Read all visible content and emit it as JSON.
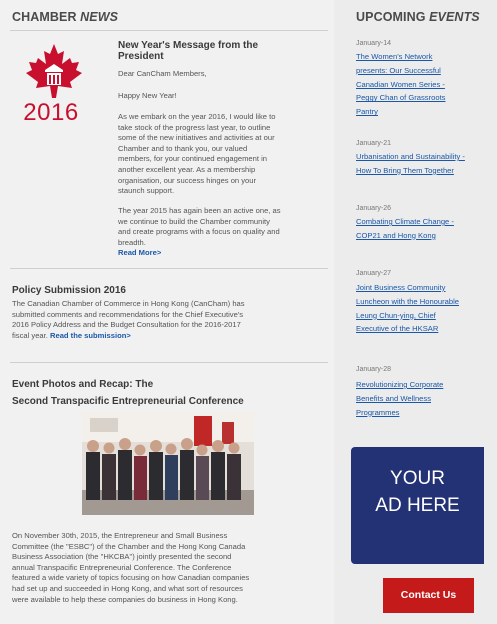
{
  "chamber_news": {
    "heading_main": "CHAMBER ",
    "heading_em": "NEWS",
    "logo_year": "2016",
    "article1": {
      "title_line1": "New Year's Message from the",
      "title_line2": "President",
      "salutation": "Dear CanCham Members,",
      "greeting": "Happy New Year!",
      "para1": [
        "As we embark on the year 2016, I would like to",
        "take stock of the progress last year, to outline",
        "some of the new initiatives and activities at our",
        "Chamber and to thank you, our valued",
        "members, for your continued engagement in",
        "another excellent year. As a membership",
        "organisation, our success hinges on your",
        "staunch support."
      ],
      "para2": [
        "The year 2015 has again been an active one, as",
        "we continue to build the Chamber community",
        "and create programs with a focus on quality and",
        "breadth."
      ],
      "read_more": "Read More>"
    },
    "article2": {
      "title": "Policy Submission 2016",
      "lines": [
        "The Canadian Chamber of Commerce in Hong Kong (CanCham) has",
        "submitted comments and recommendations for the Chief Executive's",
        "2016 Policy Address and the Budget Consultation for the 2016-2017"
      ],
      "last_line": "fiscal year. ",
      "link": "Read the submission>"
    },
    "article3": {
      "title_line1": "Event Photos and Recap: The",
      "title_line2": "Second Transpacific Entrepreneurial Conference",
      "lines": [
        "On November 30th, 2015, the Entrepreneur and Small Business",
        "Committee (the \"ESBC\") of the Chamber and the Hong Kong Canada",
        "Business Association (the \"HKCBA\") jointly presented the second",
        "annual Transpacific Entrepreneurial Conference.  The Conference",
        "featured a wide variety of topics focusing on how Canadian companies",
        "had set up and succeeded in Hong Kong, and what sort of resources",
        "were available to help these companies do business in Hong Kong."
      ]
    }
  },
  "upcoming_events": {
    "heading_main": "UPCOMING ",
    "heading_em": "EVENTS",
    "events": [
      {
        "date": "January-14",
        "lines": [
          "The Women's Network",
          "presents: Our Successful",
          "Canadian Women Series -",
          "Peggy Chan of Grassroots",
          "Pantry"
        ]
      },
      {
        "date": "January-21",
        "lines": [
          "Urbanisation and Sustainability -",
          "How To Bring Them Together"
        ]
      },
      {
        "date": "January-26",
        "lines": [
          "Combating Climate Change -",
          "COP21 and Hong Kong"
        ]
      },
      {
        "date": "January-27",
        "lines": [
          "Joint Business Community",
          "Luncheon with the Honourable",
          "Leung Chun-ying, Chief",
          "Executive of the HKSAR"
        ]
      },
      {
        "date": "January-28",
        "lines": [
          "Revolutionizing Corporate",
          "Benefits and Wellness",
          "Programmes"
        ]
      }
    ]
  },
  "ad": {
    "line1": "YOUR",
    "line2": "AD HERE"
  },
  "contact_button": "Contact Us",
  "colors": {
    "brand_red": "#c8102e",
    "link_blue": "#1a57a8",
    "ad_navy": "#233175",
    "button_red": "#c41a1a"
  }
}
